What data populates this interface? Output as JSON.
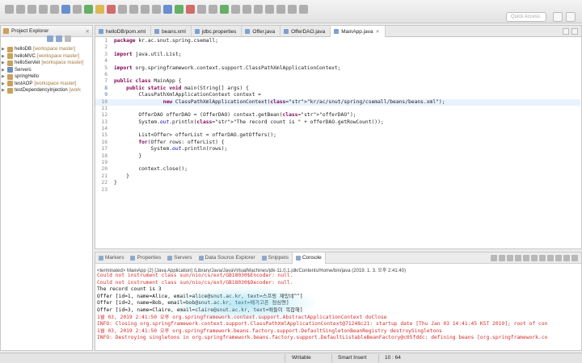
{
  "toolbar": {
    "quick_access_placeholder": "Quick Access"
  },
  "explorer": {
    "title": "Project Explorer",
    "items": [
      {
        "name": "helloDB",
        "suffix": "[workspace master]",
        "type": "project"
      },
      {
        "name": "helloMVC",
        "suffix": "[workspace master]",
        "type": "project"
      },
      {
        "name": "helloServlet",
        "suffix": "[workspace master]",
        "type": "project"
      },
      {
        "name": "Servers",
        "suffix": "",
        "type": "server"
      },
      {
        "name": "springHello",
        "suffix": "",
        "type": "project"
      },
      {
        "name": "testAOP",
        "suffix": "[workspace master]",
        "type": "project"
      },
      {
        "name": "testDependencyInjection",
        "suffix": "[work",
        "type": "project"
      }
    ]
  },
  "editor": {
    "tabs": [
      {
        "label": "helloDB/pom.xml",
        "active": false
      },
      {
        "label": "beans.xml",
        "active": false
      },
      {
        "label": "jdbc.properties",
        "active": false
      },
      {
        "label": "Offer.java",
        "active": false
      },
      {
        "label": "OfferDAO.java",
        "active": false
      },
      {
        "label": "MainApp.java",
        "active": true
      }
    ],
    "lines": [
      {
        "n": "1",
        "t": "package kr.ac.snut.spring.csemall;"
      },
      {
        "n": "2",
        "t": ""
      },
      {
        "n": "3",
        "t": "import java.util.List;"
      },
      {
        "n": "4",
        "t": ""
      },
      {
        "n": "5",
        "t": "import org.springframework.context.support.ClassPathXmlApplicationContext;"
      },
      {
        "n": "6",
        "t": ""
      },
      {
        "n": "7",
        "t": "public class MainApp {"
      },
      {
        "n": "8",
        "t": "    public static void main(String[] args) {"
      },
      {
        "n": "9",
        "t": "        ClassPathXmlApplicationContext context ="
      },
      {
        "n": "10",
        "t": "                new ClassPathXmlApplicationContext(\"kr/ac/snut/spring/csemall/beans/beans.xml\");"
      },
      {
        "n": "11",
        "t": ""
      },
      {
        "n": "12",
        "t": "        OfferDAO offerDAO = (OfferDAO) context.getBean(\"offerDAO\");"
      },
      {
        "n": "13",
        "t": "        System.out.println(\"The record count is \" + offerDAO.getRowCount());"
      },
      {
        "n": "14",
        "t": ""
      },
      {
        "n": "15",
        "t": "        List<Offer> offerList = offerDAO.getOffers();"
      },
      {
        "n": "16",
        "t": "        for(Offer rows: offerList) {"
      },
      {
        "n": "17",
        "t": "            System.out.println(rows);"
      },
      {
        "n": "18",
        "t": "        }"
      },
      {
        "n": "19",
        "t": ""
      },
      {
        "n": "20",
        "t": "        context.close();"
      },
      {
        "n": "21",
        "t": "    }"
      },
      {
        "n": "22",
        "t": "}"
      },
      {
        "n": "23",
        "t": ""
      }
    ]
  },
  "console": {
    "tabs": [
      "Markers",
      "Properties",
      "Servers",
      "Data Source Explorer",
      "Snippets",
      "Console"
    ],
    "active_tab": "Console",
    "terminated": "<terminated> MainApp (2) [Java Application] /Library/Java/JavaVirtualMachines/jdk-11.0.1.jdk/Contents/Home/bin/java (2019. 1. 3. 오후 2:41:40)",
    "lines": [
      {
        "t": "Could not instrument class sun/nio/cs/ext/GB18030$Encoder: null.",
        "c": "red"
      },
      {
        "t": "Could not instrument class sun/nio/cs/ext/GB18030$Decoder: null.",
        "c": "red"
      },
      {
        "t": "The record count is 3",
        "c": "blk"
      },
      {
        "t": "Offer [id=1, name=Alice, email=alice@snut.ac.kr, text=스프링 재밌네^^]",
        "c": "hl"
      },
      {
        "t": "Offer [id=2, name=Bob, email=bob@snut.ac.kr, text=배가고픈 점심엔]",
        "c": "hl"
      },
      {
        "t": "Offer [id=3, name=Claire, email=claire@snut.ac.kr, text=배틀이 복잡해]",
        "c": "hl"
      },
      {
        "t": "1월 03, 2019 2:41:50 오후 org.springframework.context.support.AbstractApplicationContext doClose",
        "c": "red"
      },
      {
        "t": "INFO: Closing org.springframework.context.support.ClassPathXmlApplicationContext@71248c21: startup date [Thu Jan 03 14:41:45 KST 2019]; root of con",
        "c": "red"
      },
      {
        "t": "1월 03, 2019 2:41:50 오후 org.springframework.beans.factory.support.DefaultSingletonBeanRegistry destroySingletons",
        "c": "red"
      },
      {
        "t": "INFO: Destroying singletons in org.springframework.beans.factory.support.DefaultListableBeanFactory@c05fddc: defining beans [org.springframework.co",
        "c": "red"
      }
    ]
  },
  "status": {
    "writable": "Writable",
    "insert_mode": "Smart Insert",
    "position": "10 : 64"
  }
}
